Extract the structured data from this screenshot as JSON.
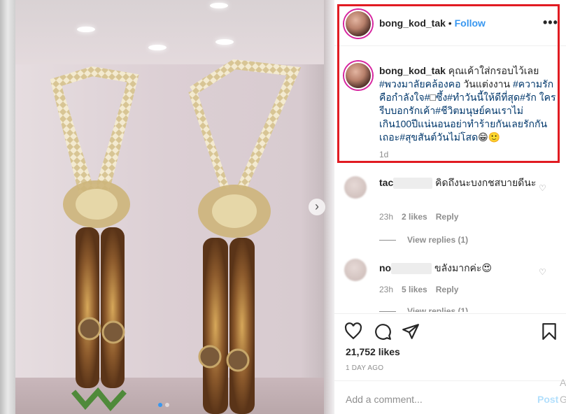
{
  "post": {
    "username": "bong_kod_tak",
    "separator": " • ",
    "follow_label": "Follow",
    "more_label": "•••",
    "caption_text": "คุณเค้าใส่กรอบไว้เลย",
    "caption_lines": [
      {
        "text": "#พวงมาลัยคล้องคอ",
        "tag": true
      },
      {
        "text": " วันแต่งงาน ",
        "tag": false
      },
      {
        "text": "#ความรัก คือกำลังใจ#",
        "tag": true
      },
      {
        "text": "□",
        "tag": false
      },
      {
        "text": "ซึ้ง#ทำวันนี้ให้ดีที่สุด#รัก ใครรีบบอกรักเค้า#ชีวิตมนุษย์คนเราไม่เกิน100ปีแน่นอนอย่าทำร้ายกันเลยรักกันเถอะ#สุขสันต์วันไม่โสด",
        "tag": true
      },
      {
        "text": "😁🙂",
        "tag": false
      }
    ],
    "caption_time": "1d"
  },
  "comments": [
    {
      "user_prefix": "tac",
      "text": "คิดถึงนะบงกชสบายดีนะ",
      "time": "23h",
      "likes": "2 likes",
      "reply": "Reply",
      "view_replies": "View replies (1)"
    },
    {
      "user_prefix": "no",
      "text": "ขลังมากค่ะ😍",
      "time": "23h",
      "likes": "5 likes",
      "reply": "Reply",
      "view_replies": "View replies (1)"
    }
  ],
  "likes_count": "21,752 likes",
  "posted_ago": "1 DAY AGO",
  "add_comment_placeholder": "Add a comment...",
  "post_button": "Post",
  "edge_letters": [
    "A",
    "G"
  ],
  "icons": {
    "next": "chevron-right-icon",
    "heart": "heart-icon",
    "comment": "comment-icon",
    "share": "share-icon",
    "save": "bookmark-icon"
  },
  "colors": {
    "link": "#3897f0",
    "hashtag": "#00376b",
    "highlight_box": "#e11b22"
  },
  "carousel": {
    "count": 2,
    "active": 0
  }
}
